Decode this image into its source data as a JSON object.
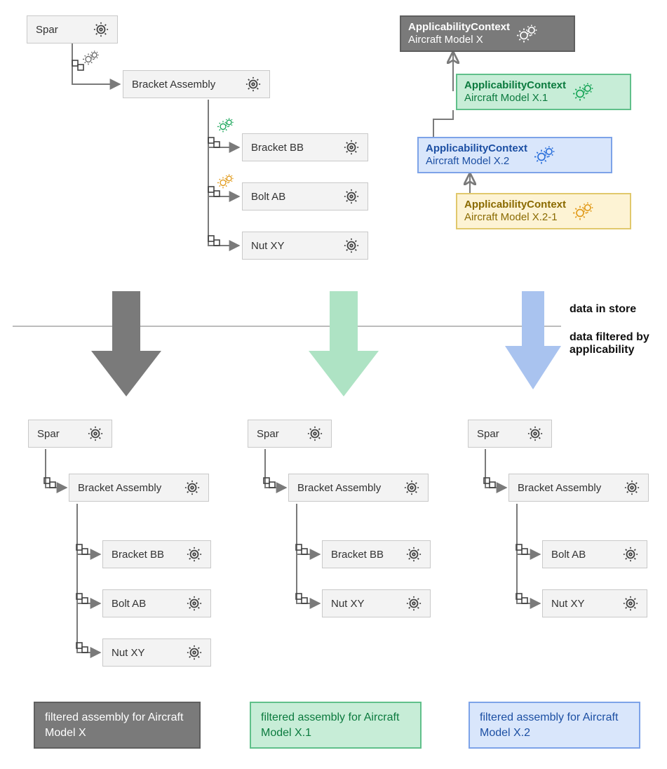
{
  "colors": {
    "gray": {
      "fill": "#7a7a7a",
      "stroke": "#7a7a7a",
      "bg": "#7a7a7a",
      "text": "#ffffff"
    },
    "green": {
      "fill": "#c7edd7",
      "stroke": "#60c08a",
      "text": "#0b7a3e",
      "iconStroke": "#18a558"
    },
    "blue": {
      "fill": "#d9e6fb",
      "stroke": "#7da3e8",
      "text": "#1c4fa3",
      "iconStroke": "#2a6fdb"
    },
    "orange": {
      "fill": "#fdf3d4",
      "stroke": "#e1c86c",
      "text": "#8a6a00",
      "iconStroke": "#e19a1a"
    },
    "gearGray": "#444"
  },
  "labels": {
    "spar": "Spar",
    "bracketAssembly": "Bracket Assembly",
    "bracketBB": "Bracket BB",
    "boltAB": "Bolt AB",
    "nutXY": "Nut XY",
    "ctxTitle": "ApplicabilityContext",
    "ctxX": "Aircraft Model X",
    "ctxX1": "Aircraft Model X.1",
    "ctxX2": "Aircraft Model X.2",
    "ctxX21": "Aircraft Model X.2-1",
    "dataInStore": "data in store",
    "dataFiltered": "data filtered by applicability",
    "capX": "filtered assembly for Aircraft Model X",
    "capX1": "filtered assembly for Aircraft Model X.1",
    "capX2": "filtered assembly for Aircraft Model X.2"
  }
}
